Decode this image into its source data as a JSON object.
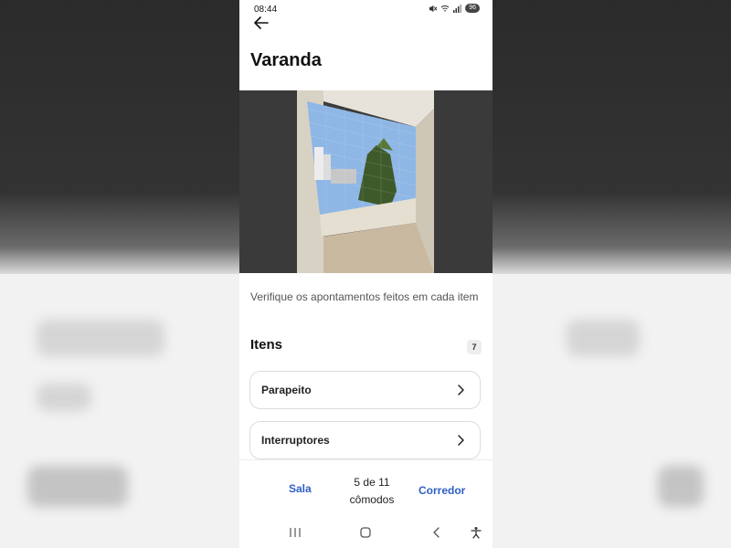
{
  "status_bar": {
    "time": "08:44",
    "battery": "96"
  },
  "page": {
    "title": "Varanda",
    "hint": "Verifique os apontamentos feitos em cada item"
  },
  "items_section": {
    "heading": "Itens",
    "count": "7",
    "items": [
      {
        "label": "Parapeito"
      },
      {
        "label": "Interruptores"
      }
    ]
  },
  "bottom_nav": {
    "prev_label": "Sala",
    "position_line1": "5 de 11",
    "position_line2": "cômodos",
    "next_label": "Corredor"
  },
  "icons": {
    "back": "arrow-left-icon",
    "chevron": "chevron-right-icon",
    "system_recents": "recents-icon",
    "system_home": "home-icon",
    "system_back": "back-icon",
    "accessibility": "accessibility-icon"
  },
  "colors": {
    "accent": "#2f5fc4",
    "text": "#111111"
  }
}
